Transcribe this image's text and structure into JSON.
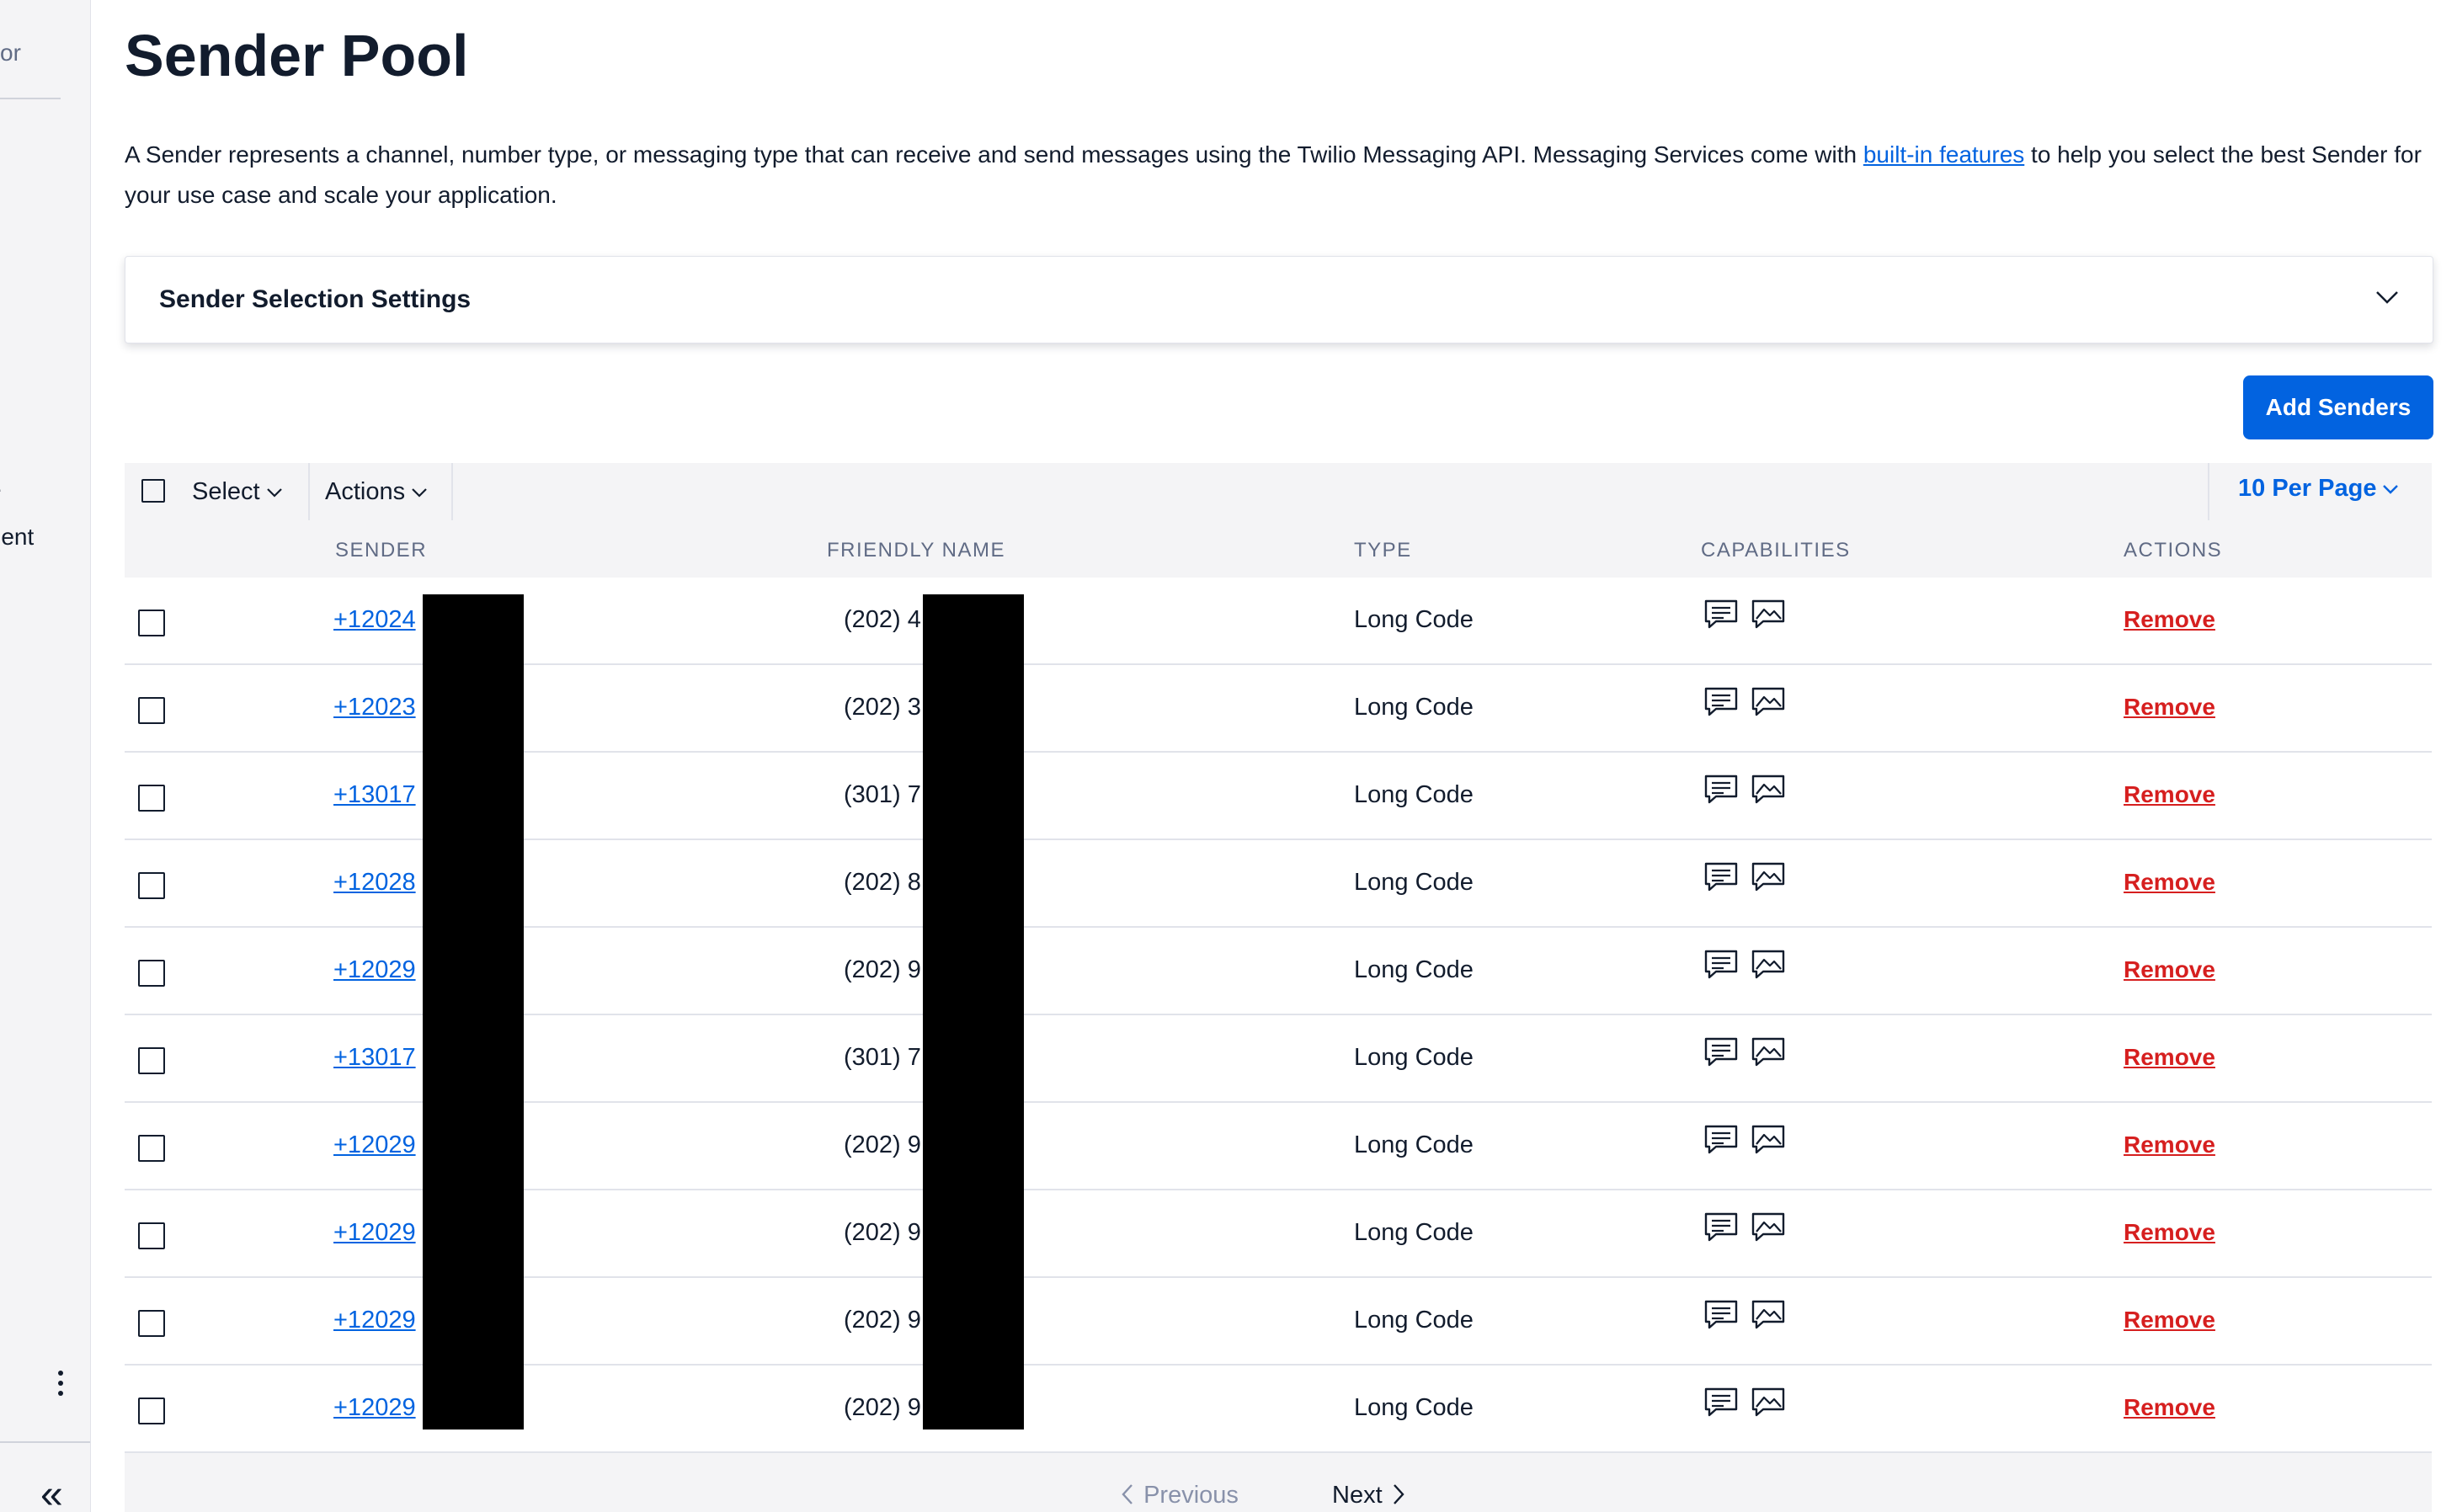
{
  "sidebar": {
    "top_item": "itor",
    "item_a": "e",
    "item_b": "ment",
    "collapse_glyph": "«"
  },
  "page": {
    "title": "Sender Pool",
    "intro_before": "A Sender represents a channel, number type, or messaging type that can receive and send messages using the Twilio Messaging API. Messaging Services come with ",
    "intro_link": "built-in features",
    "intro_after": " to help you select the best Sender for your use case and scale your application."
  },
  "settings": {
    "title": "Sender Selection Settings"
  },
  "add_button": "Add Senders",
  "toolbar": {
    "select": "Select",
    "actions": "Actions",
    "per_page": "10 Per Page"
  },
  "columns": [
    "SENDER",
    "FRIENDLY NAME",
    "TYPE",
    "CAPABILITIES",
    "ACTIONS"
  ],
  "rows": [
    {
      "sender": "+12024",
      "friendly": "(202) 4",
      "type": "Long Code",
      "action": "Remove"
    },
    {
      "sender": "+12023",
      "friendly": "(202) 3",
      "type": "Long Code",
      "action": "Remove"
    },
    {
      "sender": "+13017",
      "friendly": "(301) 7",
      "type": "Long Code",
      "action": "Remove"
    },
    {
      "sender": "+12028",
      "friendly": "(202) 8",
      "type": "Long Code",
      "action": "Remove"
    },
    {
      "sender": "+12029",
      "friendly": "(202) 9",
      "type": "Long Code",
      "action": "Remove"
    },
    {
      "sender": "+13017",
      "friendly": "(301) 7",
      "type": "Long Code",
      "action": "Remove"
    },
    {
      "sender": "+12029",
      "friendly": "(202) 9",
      "type": "Long Code",
      "action": "Remove"
    },
    {
      "sender": "+12029",
      "friendly": "(202) 9",
      "type": "Long Code",
      "action": "Remove"
    },
    {
      "sender": "+12029",
      "friendly": "(202) 9",
      "type": "Long Code",
      "action": "Remove"
    },
    {
      "sender": "+12029",
      "friendly": "(202) 9",
      "type": "Long Code",
      "action": "Remove"
    }
  ],
  "pager": {
    "previous": "Previous",
    "next": "Next"
  },
  "colors": {
    "accent": "#0263e0",
    "danger": "#d61f1f",
    "text": "#121c2d",
    "muted": "#606b85"
  }
}
